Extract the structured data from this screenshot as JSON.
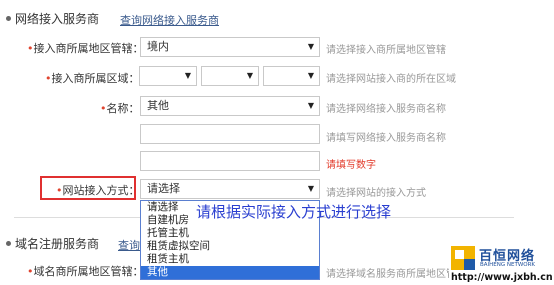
{
  "section1": {
    "title": "网络接入服务商",
    "link": "查询网络接入服务商"
  },
  "fields": {
    "region_mgmt": {
      "label": "接入商所属地区管辖：",
      "value": "境内",
      "hint": "请选择接入商所属地区管辖"
    },
    "region": {
      "label": "接入商所属区域：",
      "hint": "请选择网站接入商的所在区域"
    },
    "name": {
      "label": "名称：",
      "value": "其他",
      "hint": "请选择网络接入服务商名称",
      "hint2": "请填写网络接入服务商名称"
    },
    "captcha": {
      "hint": "请填写数字"
    },
    "access_method": {
      "label": "网站接入方式：",
      "value": "请选择",
      "hint": "请选择网站的接入方式",
      "options": [
        "请选择",
        "自建机房",
        "托管主机",
        "租赁虚拟空间",
        "租赁主机",
        "其他"
      ],
      "selected_index": 5
    }
  },
  "annotation": "请根据实际接入方式进行选择",
  "section2": {
    "title": "域名注册服务商",
    "link": "查询"
  },
  "domain_region": {
    "label": "域名商所属地区管辖：",
    "hint": "请选择域名服务商所属地区管"
  },
  "logo": {
    "cn": "百恒网络",
    "en": "BAIHENG NETWORK",
    "url": "http://www.jxbh.cn"
  },
  "colors": {
    "required": "#e0442f",
    "link": "#3a5a8c",
    "selected": "#2f6fd8",
    "annotation": "#2a3fd0",
    "highlight": "#e03030"
  }
}
